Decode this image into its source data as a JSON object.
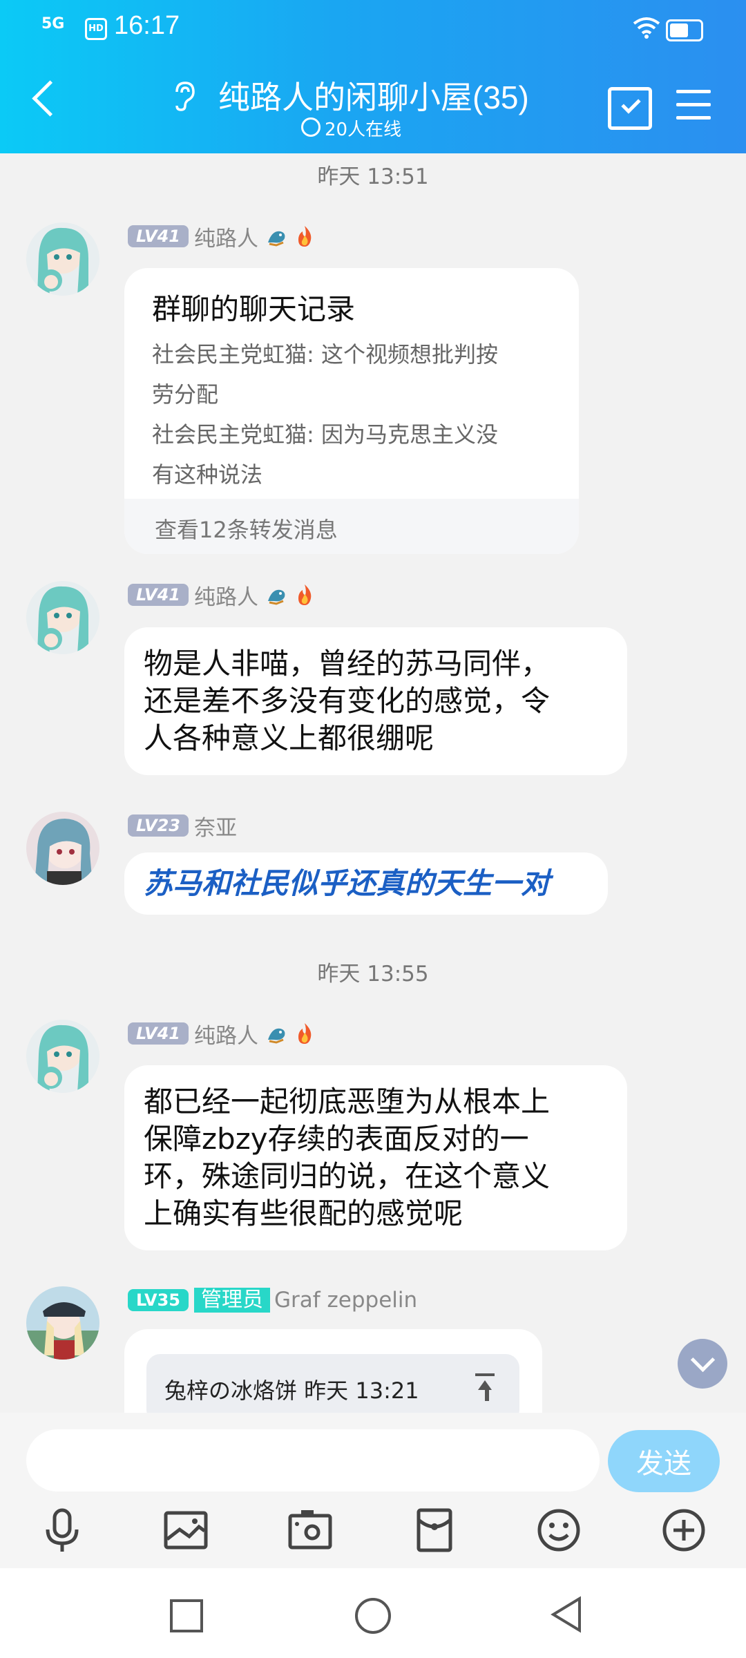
{
  "status": {
    "network": "5G",
    "hd": "HD",
    "time": "16:17"
  },
  "header": {
    "title": "纯路人的闲聊小屋(35)",
    "online": "20人在线"
  },
  "timestamps": {
    "t1": "昨天 13:51",
    "t2": "昨天 13:55"
  },
  "messages": [
    {
      "level": "LV41",
      "name": "纯路人",
      "forward": {
        "title": "群聊的聊天记录",
        "line1a": "社会民主党虹猫: 这个视频想批判按",
        "line1b": "劳分配",
        "line2a": "社会民主党虹猫: 因为马克思主义没",
        "line2b": "有这种说法",
        "footer": "查看12条转发消息"
      }
    },
    {
      "level": "LV41",
      "name": "纯路人",
      "lines": [
        "物是人非喵，曾经的苏马同伴，",
        "还是差不多没有变化的感觉，令",
        "人各种意义上都很绷呢"
      ]
    },
    {
      "level": "LV23",
      "name": "奈亚",
      "text": "苏马和社民似乎还真的天生一对"
    },
    {
      "level": "LV41",
      "name": "纯路人",
      "lines": [
        "都已经一起彻底恶堕为从根本上",
        "保障zbzy存续的表面反对的一",
        "环，殊途同归的说，在这个意义",
        "上确实有些很配的感觉呢"
      ]
    },
    {
      "level": "LV35",
      "role": "管理员",
      "name": "Graf zeppelin",
      "quote": "兔梓の冰烙饼  昨天 13:21"
    }
  ],
  "composer": {
    "placeholder": "",
    "send_label": "发送"
  },
  "toolbar": [
    "mic-icon",
    "image-icon",
    "camera-icon",
    "redpacket-icon",
    "emoji-icon",
    "plus-icon"
  ],
  "colors": {
    "header_start": "#0bcaf6",
    "header_end": "#2b8ff0",
    "highlight_text": "#1b5fc4",
    "admin_badge": "#28d7c8"
  }
}
